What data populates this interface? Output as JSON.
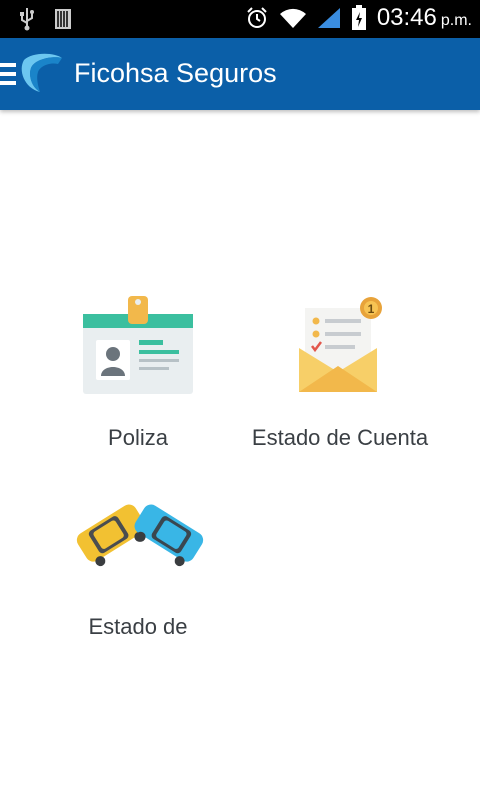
{
  "status_bar": {
    "time": "03:46",
    "ampm": "p.m.",
    "icons": [
      "usb-icon",
      "sim-icon",
      "alarm-icon",
      "wifi-icon",
      "signal-icon",
      "battery-icon"
    ]
  },
  "app_bar": {
    "title": "Ficohsa Seguros",
    "color": "#0b5fa8"
  },
  "menu": {
    "items": [
      {
        "label": "Poliza",
        "icon": "id-card-icon"
      },
      {
        "label": "Estado de Cuenta",
        "icon": "envelope-icon",
        "badge": "1"
      },
      {
        "label": "Estado de",
        "icon": "car-crash-icon"
      }
    ]
  }
}
